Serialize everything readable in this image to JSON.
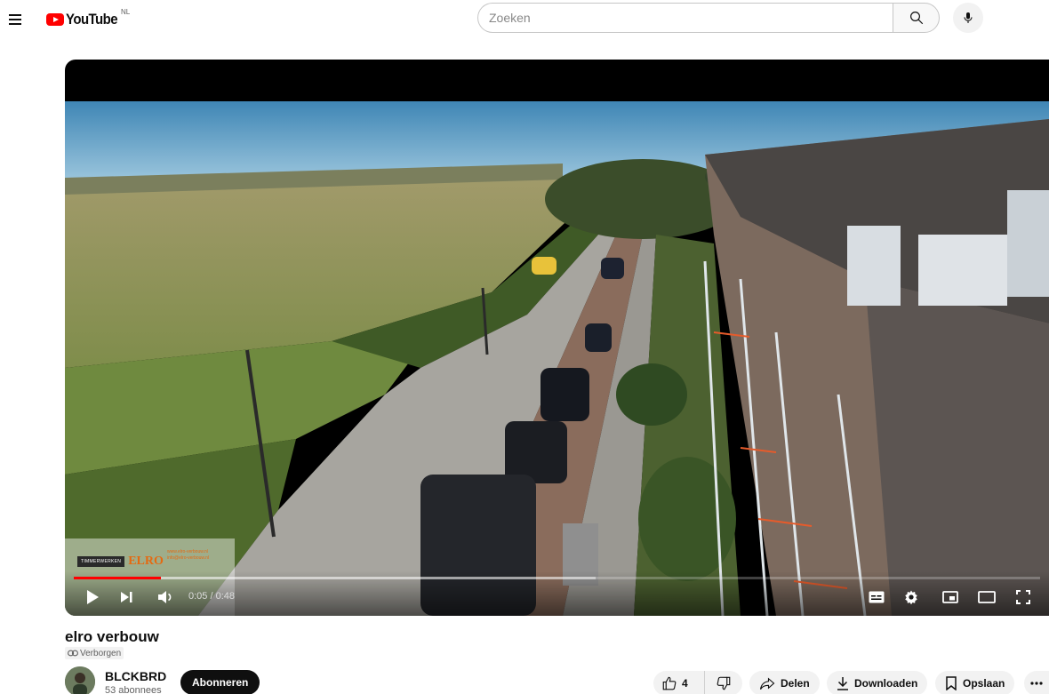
{
  "header": {
    "logo_text": "YouTube",
    "region": "NL",
    "search_placeholder": "Zoeken"
  },
  "player": {
    "time": "0:05 / 0:48",
    "progress_played": 0.09,
    "progress_buffered": 0.54,
    "overlay_brand_left": "TIMMERWERKEN",
    "overlay_brand_right": "ELRO",
    "overlay_info": [
      "www.elro-verbouw.nl",
      "info@elro-verbouw.nl"
    ]
  },
  "video": {
    "title": "elro verbouw",
    "visibility": "Verborgen"
  },
  "channel": {
    "name": "BLCKBRD",
    "subscribers": "53 abonnees",
    "subscribe_label": "Abonneren"
  },
  "actions": {
    "like_count": "4",
    "share_label": "Delen",
    "download_label": "Downloaden",
    "save_label": "Opslaan"
  },
  "colors": {
    "accent": "#ff0000",
    "text": "#0f0f0f",
    "muted": "#606060",
    "pill": "#f2f2f2"
  }
}
